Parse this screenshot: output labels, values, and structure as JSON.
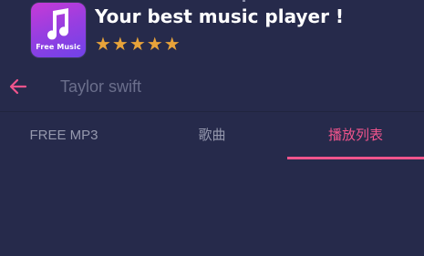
{
  "ad": {
    "title": "Your best music player !",
    "stars": "★★★★★",
    "app_icon_label": "Free Music",
    "app_icon_glyph": "music-note-icon"
  },
  "search": {
    "query": "Taylor swift",
    "back_icon": "arrow-left-icon"
  },
  "tabs": [
    {
      "label": "FREE MP3",
      "active": false
    },
    {
      "label": "歌曲",
      "active": false
    },
    {
      "label": "播放列表",
      "active": true
    }
  ],
  "colors": {
    "background": "#262a4b",
    "accent": "#f0548c",
    "star": "#e8a33a",
    "tab_inactive": "#9598ad"
  }
}
